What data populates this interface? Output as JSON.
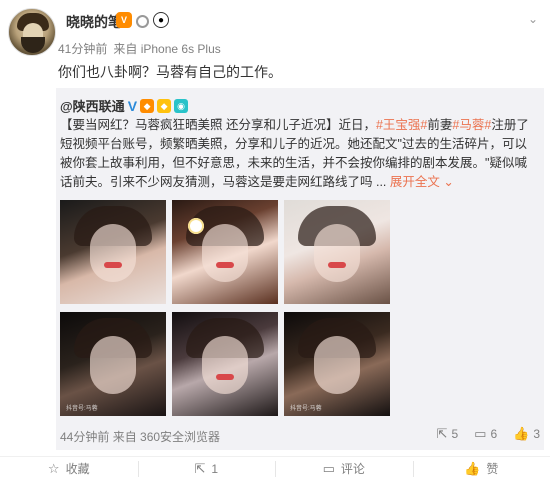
{
  "post": {
    "username": "晓晓的笔",
    "meta_time": "41分钟前",
    "meta_source": "来自 iPhone 6s Plus",
    "text": "你们也八卦啊？马蓉有自己的工作。"
  },
  "repost": {
    "author": "@陕西联通",
    "text_parts": {
      "p1": "【要当网红？马蓉疯狂晒美照 还分享和儿子近况】近日，",
      "tag1": "#王宝强#",
      "p2": "前妻",
      "tag2": "#马蓉#",
      "p3": "注册了短视频平台账号，频繁晒美照，分享和儿子的近况。她还配文\"过去的生活碎片，可以被你套上故事利用，但不好意思，未来的生活，并不会按你编排的剧本发展。\"疑似喊话前夫。引来不少网友猜测，马蓉这是要走网红路线了吗 ...",
      "expand": "展开全文"
    },
    "photo_watermark": "抖音号:马蓉",
    "meta_time": "44分钟前",
    "meta_source": "来自 360安全浏览器",
    "counts": {
      "share": "5",
      "comment": "6",
      "like": "3"
    }
  },
  "actions": {
    "favorite": "收藏",
    "forward": "1",
    "comment": "评论",
    "like": "赞"
  }
}
